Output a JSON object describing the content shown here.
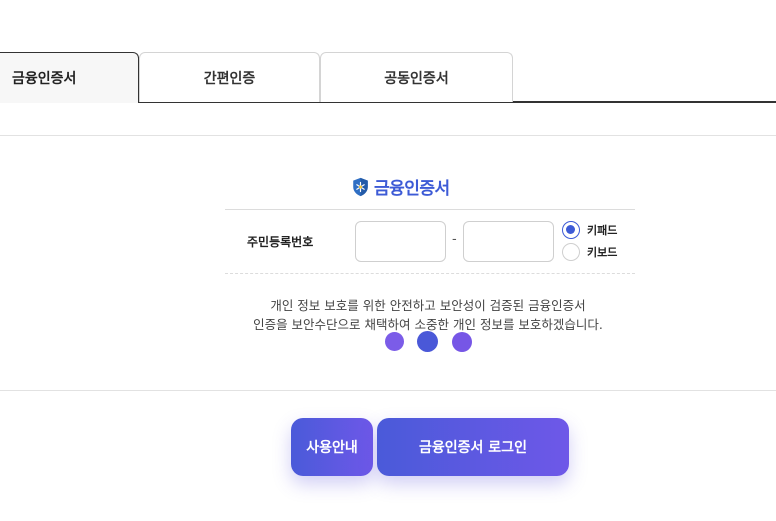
{
  "tabs": [
    {
      "label": "금융인증서",
      "active": true
    },
    {
      "label": "간편인증",
      "active": false
    },
    {
      "label": "공동인증서",
      "active": false
    }
  ],
  "cert": {
    "title": "금융인증서",
    "icon": "shield-icon"
  },
  "form": {
    "rrn_label": "주민등록번호",
    "front_value": "",
    "back_value": "",
    "separator": "-",
    "keyboard_options": [
      {
        "label": "키패드",
        "checked": true
      },
      {
        "label": "키보드",
        "checked": false
      }
    ]
  },
  "notice": {
    "line1": "개인 정보 보호를 위한 안전하고 보안성이 검증된 금융인증서",
    "line2": "인증을 보안수단으로 채택하여 소중한 개인 정보를 보호하겠습니다."
  },
  "buttons": {
    "guide": "사용안내",
    "login": "금융인증서 로그인"
  },
  "colors": {
    "accent": "#3d5bd6",
    "gradient_start": "#4a5ad9",
    "gradient_end": "#6e58e8"
  }
}
